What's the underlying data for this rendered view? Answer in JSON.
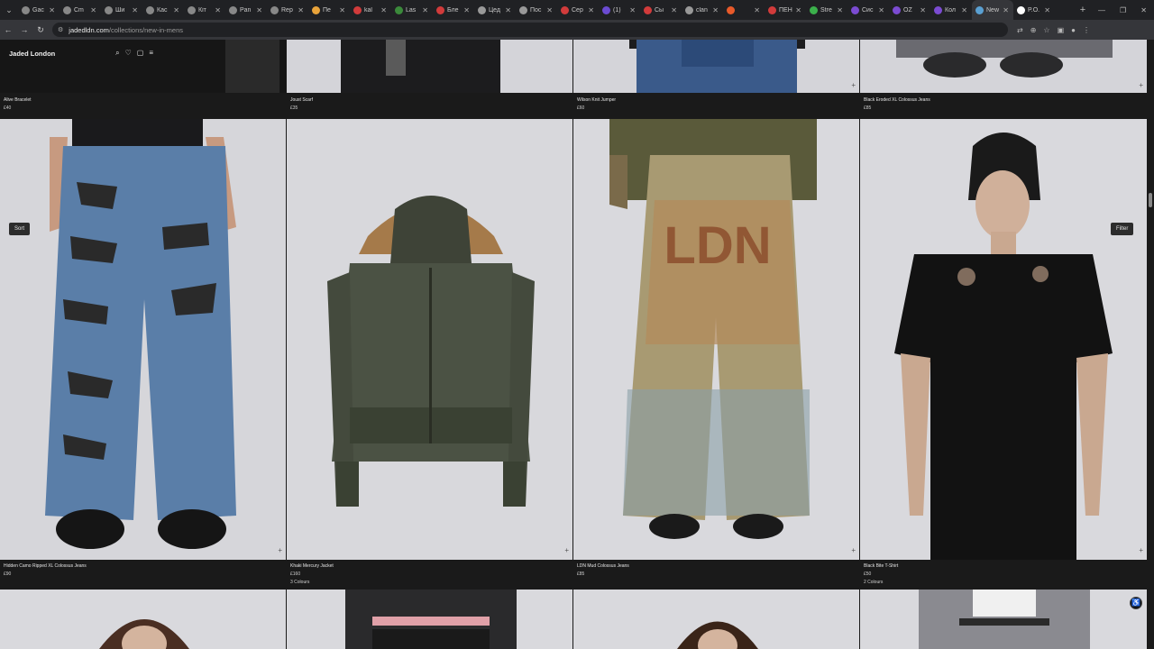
{
  "browser": {
    "tabs": [
      {
        "label": "Gac",
        "color": "#888888"
      },
      {
        "label": "Cm",
        "color": "#888888"
      },
      {
        "label": "Ши",
        "color": "#888888"
      },
      {
        "label": "Кас",
        "color": "#888888"
      },
      {
        "label": "Кіт",
        "color": "#888888"
      },
      {
        "label": "Pan",
        "color": "#888888"
      },
      {
        "label": "Rep",
        "color": "#888888"
      },
      {
        "label": "Пе",
        "color": "#e8a33a"
      },
      {
        "label": "kal",
        "color": "#d23b3b"
      },
      {
        "label": "Las",
        "color": "#3b8a3b"
      },
      {
        "label": "Бле",
        "color": "#d23b3b"
      },
      {
        "label": "Цед",
        "color": "#999999"
      },
      {
        "label": "Пос",
        "color": "#999999"
      },
      {
        "label": "Сер",
        "color": "#d23b3b"
      },
      {
        "label": "(1)",
        "color": "#6b4bd2"
      },
      {
        "label": "Сы",
        "color": "#d23b3b"
      },
      {
        "label": "clan",
        "color": "#999999"
      },
      {
        "label": "",
        "color": "#e85a2a"
      },
      {
        "label": "ПЕН",
        "color": "#d23b3b"
      },
      {
        "label": "Stre",
        "color": "#3bb04b"
      },
      {
        "label": "Сис",
        "color": "#7b4bd2"
      },
      {
        "label": "OZ",
        "color": "#7b4bd2"
      },
      {
        "label": "Кол",
        "color": "#7b4bd2"
      },
      {
        "label": "New",
        "color": "#5aa0d2",
        "active": true
      },
      {
        "label": "P.O.",
        "color": "#ffffff"
      }
    ],
    "url_domain": "jadedldn.com",
    "url_path": "/collections/new-in-mens"
  },
  "site": {
    "logo": "Jaded London",
    "sort_label": "Sort",
    "filter_label": "Filter"
  },
  "top_row": [
    {
      "name": "Alive Bracelet",
      "price": "£40"
    },
    {
      "name": "Joust Scarf",
      "price": "£35"
    },
    {
      "name": "Wilson Knit Jumper",
      "price": "£60"
    },
    {
      "name": "Black Eroded XL Colossus Jeans",
      "price": "£85"
    }
  ],
  "main_row": [
    {
      "name": "Hidden Camo Ripped XL Colossus Jeans",
      "price": "£90",
      "colours": ""
    },
    {
      "name": "Khaki Mercury Jacket",
      "price": "£160",
      "colours": "3 Colours"
    },
    {
      "name": "LDN Mud Colossus Jeans",
      "price": "£85",
      "colours": ""
    },
    {
      "name": "Black Bite T-Shirt",
      "price": "£50",
      "colours": "2 Colours"
    }
  ],
  "mud_jeans_print": "LDN",
  "plus_symbol": "+"
}
